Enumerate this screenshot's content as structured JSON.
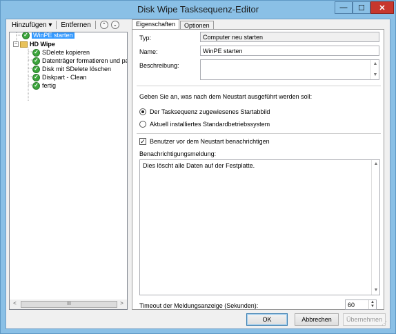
{
  "window": {
    "title": "Disk Wipe Tasksequenz-Editor",
    "controls": {
      "minimize": "—",
      "maximize": "☐",
      "close": "✕"
    }
  },
  "toolbar": {
    "add_label": "Hinzufügen ▾",
    "remove_label": "Entfernen",
    "move_up_glyph": "⌃",
    "move_down_glyph": "⌄"
  },
  "tree": {
    "items": [
      {
        "label": "WinPE starten",
        "selected": true,
        "icon": "check-icon"
      },
      {
        "label": "HD Wipe",
        "group": true,
        "icon": "folder-icon"
      },
      {
        "label": "SDelete kopieren",
        "icon": "check-icon"
      },
      {
        "label": "Datenträger formatieren und partit",
        "icon": "check-icon"
      },
      {
        "label": "Disk mit SDelete löschen",
        "icon": "check-icon"
      },
      {
        "label": "Diskpart - Clean",
        "icon": "check-icon"
      },
      {
        "label": "fertig",
        "icon": "check-icon"
      }
    ],
    "scrollbar": {
      "left": "<",
      "right": ">",
      "thumb": "III"
    }
  },
  "tabs": [
    {
      "label": "Eigenschaften",
      "active": true
    },
    {
      "label": "Optionen",
      "active": false
    }
  ],
  "properties": {
    "type_label": "Typ:",
    "type_value": "Computer neu starten",
    "name_label": "Name:",
    "name_value": "WinPE starten",
    "description_label": "Beschreibung:",
    "description_value": "",
    "restart_question": "Geben Sie an, was nach dem Neustart ausgeführt werden soll:",
    "radio_options": [
      {
        "label": "Der Tasksequenz zugewiesenes Startabbild",
        "selected": true
      },
      {
        "label": "Aktuell installiertes Standardbetriebssystem",
        "selected": false
      }
    ],
    "notify_checkbox_label": "Benutzer vor dem Neustart benachrichtigen",
    "notify_checked": true,
    "message_label": "Benachrichtigungsmeldung:",
    "message_value": "Dies löscht alle Daten auf der Festplatte.",
    "timeout_label": "Timeout der Meldungsanzeige (Sekunden):",
    "timeout_value": "60"
  },
  "buttons": {
    "ok": "OK",
    "cancel": "Abbrechen",
    "apply": "Übernehmen"
  }
}
